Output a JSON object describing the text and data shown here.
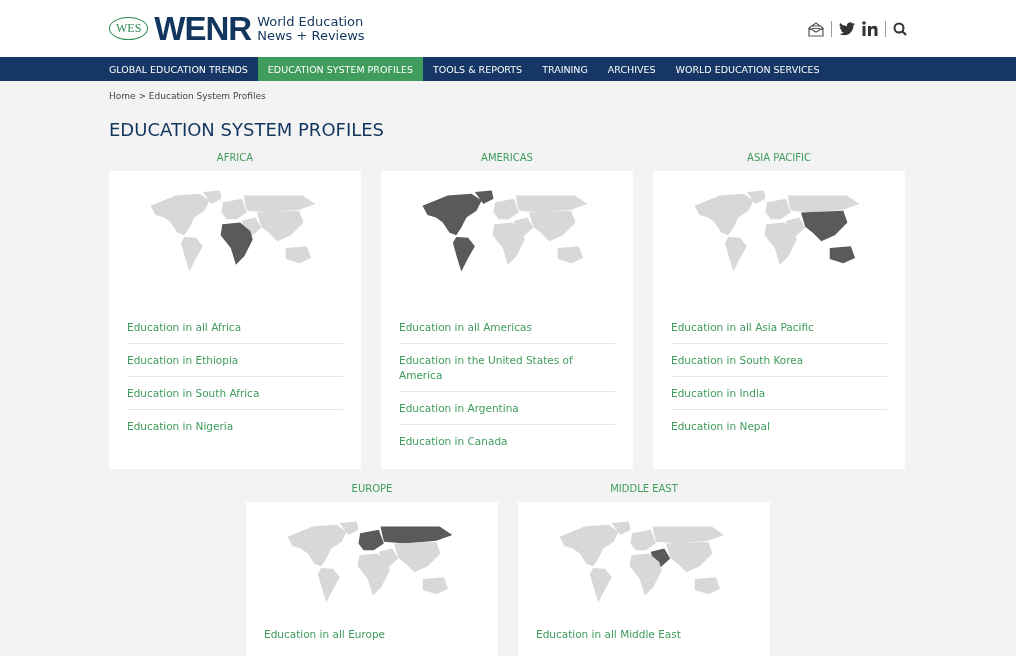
{
  "logo": {
    "badge": "WES",
    "wordmark": "WENR",
    "tagline_line_1": "World Education",
    "tagline_line_2": "News + Reviews"
  },
  "nav": [
    {
      "label": "GLOBAL EDUCATION TRENDS",
      "selected": false
    },
    {
      "label": "EDUCATION SYSTEM PROFILES",
      "selected": true
    },
    {
      "label": "TOOLS & REPORTS",
      "selected": false
    },
    {
      "label": "TRAINING",
      "selected": false
    },
    {
      "label": "ARCHIVES",
      "selected": false
    },
    {
      "label": "WORLD EDUCATION SERVICES",
      "selected": false
    }
  ],
  "breadcrumb": "Home > Education System Profiles",
  "page_title": "EDUCATION SYSTEM PROFILES",
  "regions": [
    {
      "name": "AFRICA",
      "kind": "africa",
      "links": [
        "Education in all Africa",
        "Education in Ethiopia",
        "Education in South Africa",
        "Education in Nigeria"
      ]
    },
    {
      "name": "AMERICAS",
      "kind": "americas",
      "links": [
        "Education in all Americas",
        "Education in the United States of America",
        "Education in Argentina",
        "Education in Canada"
      ]
    },
    {
      "name": "ASIA PACIFIC",
      "kind": "asia_pacific",
      "links": [
        "Education in all Asia Pacific",
        "Education in South Korea",
        "Education in India",
        "Education in Nepal"
      ]
    },
    {
      "name": "EUROPE",
      "kind": "europe",
      "links": [
        "Education in all Europe"
      ]
    },
    {
      "name": "MIDDLE EAST",
      "kind": "middle_east",
      "links": [
        "Education in all Middle East"
      ]
    }
  ]
}
